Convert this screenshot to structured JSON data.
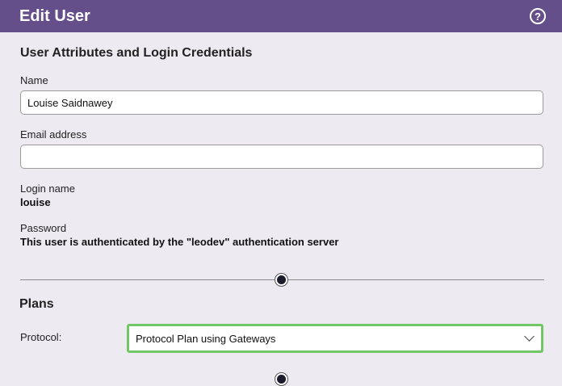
{
  "window": {
    "title": "Edit User",
    "help_icon": "question-circle-icon",
    "help_glyph": "?"
  },
  "attributes": {
    "section_title": "User Attributes and Login Credentials",
    "name_label": "Name",
    "name_value": "Louise Saidnawey",
    "email_label": "Email address",
    "email_value": "",
    "login_label": "Login name",
    "login_value": "louise",
    "password_label": "Password",
    "password_value": "This user is authenticated by the \"leodev\" authentication server"
  },
  "plans": {
    "section_title": "Plans",
    "protocol_label": "Protocol:",
    "protocol_selected": "Protocol Plan using Gateways"
  },
  "colors": {
    "titlebar": "#654f8a",
    "background": "#edeaf2",
    "focus_border": "#71c765"
  }
}
